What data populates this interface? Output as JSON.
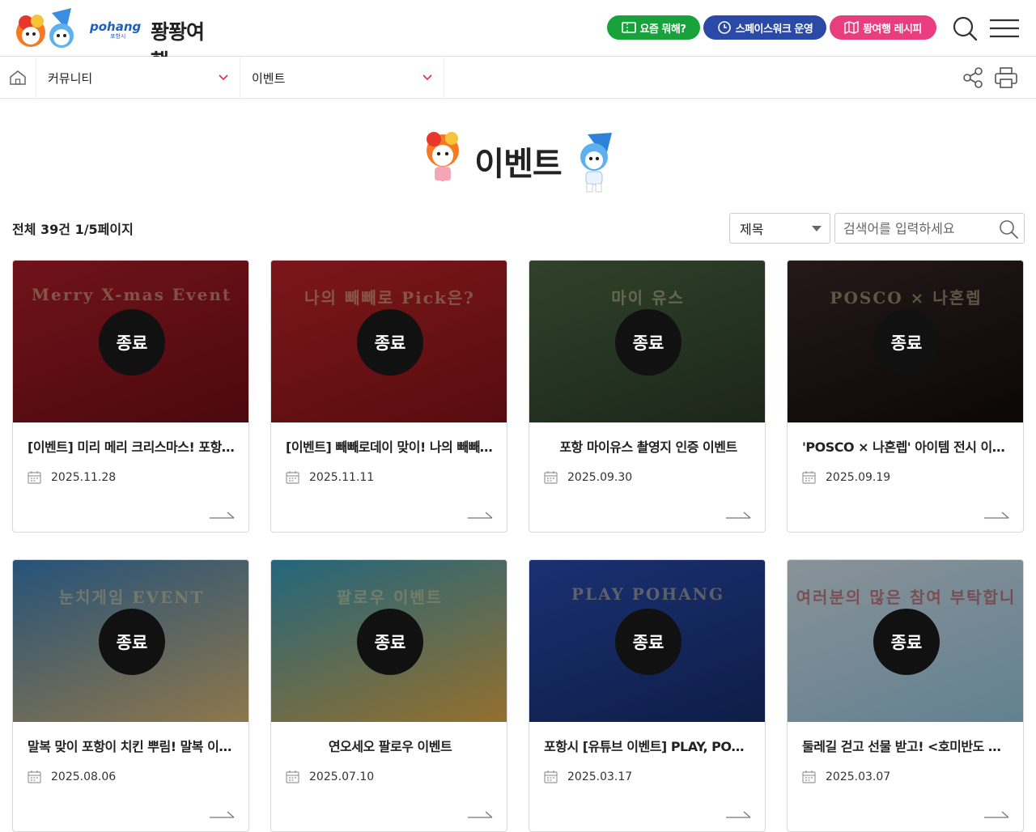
{
  "header": {
    "brand": "pohang",
    "brand_sub": "포항시",
    "site_name": "퐝퐝여행",
    "buttons": [
      {
        "label": "요즘 뭐해?",
        "icon": "ticket-icon",
        "color": "#17a23b"
      },
      {
        "label": "스페이스워크 운영",
        "icon": "clock-icon",
        "color": "#2b4aa8"
      },
      {
        "label": "퐝여행 레시피",
        "icon": "map-icon",
        "color": "#e83d7e"
      }
    ]
  },
  "breadcrumb": {
    "level1": "커뮤니티",
    "level2": "이벤트"
  },
  "page": {
    "title": "이벤트",
    "total_info": "전체 39건 1/5페이지"
  },
  "search": {
    "field_selected": "제목",
    "placeholder": "검색어를 입력하세요"
  },
  "cards": [
    {
      "title": "[이벤트] 미리 메리 크리스마스! 포항 크리스마스 이벤트",
      "date": "2025.11.28",
      "status": "종료",
      "thumb_text": "Merry X-mas Event",
      "bg": "#b51f2a",
      "bg2": "#7a0f18"
    },
    {
      "title": "[이벤트] 빼빼로데이 맞이! 나의 빼빼로 Pick 이벤트",
      "date": "2025.11.11",
      "status": "종료",
      "thumb_text": "나의 빼빼로 Pick은?",
      "bg": "#c8262c",
      "bg2": "#8e1419"
    },
    {
      "title": "포항 마이유스 촬영지 인증 이벤트",
      "date": "2025.09.30",
      "status": "종료",
      "thumb_text": "마이 유스",
      "bg": "#4e6b45",
      "bg2": "#2d3f2a"
    },
    {
      "title": "'POSCO × 나혼렙' 아이템 전시 이벤트",
      "date": "2025.09.19",
      "status": "종료",
      "thumb_text": "POSCO × 나혼렙",
      "bg": "#3a2a28",
      "bg2": "#140c0c"
    },
    {
      "title": "말복 맞이 포항이 치킨 뿌림! 말복 이벤트",
      "date": "2025.08.06",
      "status": "종료",
      "thumb_text": "눈치게임 EVENT",
      "bg": "#3e86c4",
      "bg2": "#e6c07a"
    },
    {
      "title": "연오세오 팔로우 이벤트",
      "date": "2025.07.10",
      "status": "종료",
      "thumb_text": "팔로우 이벤트",
      "bg": "#39a5c9",
      "bg2": "#f0b54a"
    },
    {
      "title": "포항시 [유튜브 이벤트] PLAY, POHANG 이벤트",
      "date": "2025.03.17",
      "status": "종료",
      "thumb_text": "PLAY POHANG",
      "bg": "#2b4fb8",
      "bg2": "#173073"
    },
    {
      "title": "둘레길 걷고 선물 받고! <호미반도 해안둘레길> 이벤트",
      "date": "2025.03.07",
      "status": "종료",
      "thumb_text": "여러분의 많은 참여 부탁합니다!",
      "bg": "#dcecf6",
      "bg2": "#9fd0ea"
    }
  ]
}
